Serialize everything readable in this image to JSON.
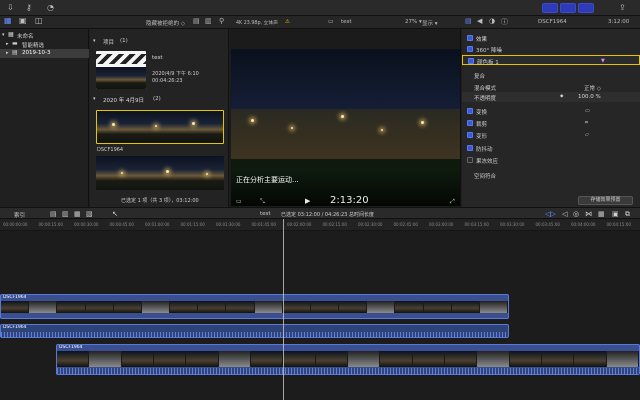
{
  "colors": {
    "accent": "#2d3bb8",
    "warning": "#f0c000",
    "clip_blue": "#3a4f8f"
  },
  "toolbar": {
    "left_icons": [
      "download-icon",
      "key-icon",
      "checkmark-circle-icon"
    ],
    "share_icon": "share-icon"
  },
  "browser_header": {
    "filter_label": "隐藏被拒绝的 ◇",
    "format": "4K 23.98p, 立体声",
    "clip_title": "test",
    "zoom": "27% ▾",
    "view_label": "显示 ▾",
    "inspector_title": "DSCF1964",
    "inspector_time": "3:12:00"
  },
  "library": {
    "items": [
      {
        "label": "未命名"
      },
      {
        "label": "智能精选"
      },
      {
        "label": "2019-10-3"
      }
    ]
  },
  "browser": {
    "section_projects": "项目",
    "section_projects_count": "(1)",
    "project_name": "test",
    "project_date": "2020/4/9 下午 6:10",
    "project_duration": "00:04:26:23",
    "section_date": "2020 年 4月9日",
    "section_date_count": "(2)",
    "clip1_name": "DSCF1964",
    "footer": "已选定 1 项（共 3 项），03:12:00"
  },
  "viewer": {
    "status_text": "正在分析主要运动...",
    "timecode": "2:13:20"
  },
  "inspector": {
    "rows": [
      {
        "label": "效果",
        "checked": true
      },
      {
        "label": "360° 降噪",
        "checked": true
      },
      {
        "label": "颜色板 1",
        "checked": true
      }
    ],
    "composite_header": "复合",
    "blend_mode_label": "混合模式",
    "blend_mode_value": "正常 ◇",
    "opacity_label": "不透明度",
    "opacity_value": "100.0 %",
    "transform_rows": [
      {
        "label": "变换",
        "checked": true
      },
      {
        "label": "裁剪",
        "checked": true
      },
      {
        "label": "变形",
        "checked": true
      },
      {
        "label": "防抖动",
        "checked": true
      },
      {
        "label": "果冻效应",
        "checked": false
      }
    ],
    "spatial_label": "空间符合",
    "save_button": "存储效果预置"
  },
  "timeline_bar": {
    "index_label": "索引",
    "project_name": "test",
    "selection_info": "已选定 03:12:00 / 04:26:23 总时间长度"
  },
  "ruler": {
    "ticks": [
      "00:00:00:00",
      "00:00:15:00",
      "00:00:30:00",
      "00:00:45:00",
      "00:01:00:00",
      "00:01:15:00",
      "00:01:30:00",
      "00:01:45:00",
      "00:02:00:00",
      "00:02:15:00",
      "00:02:30:00",
      "00:02:45:00",
      "00:03:00:00",
      "00:03:15:00",
      "00:03:30:00",
      "00:03:45:00",
      "00:04:00:00",
      "00:04:15:00"
    ]
  },
  "timeline": {
    "clip_a": "DSCF1964",
    "clip_b": "DSCF1964",
    "clip_c": "DSCF1964"
  }
}
